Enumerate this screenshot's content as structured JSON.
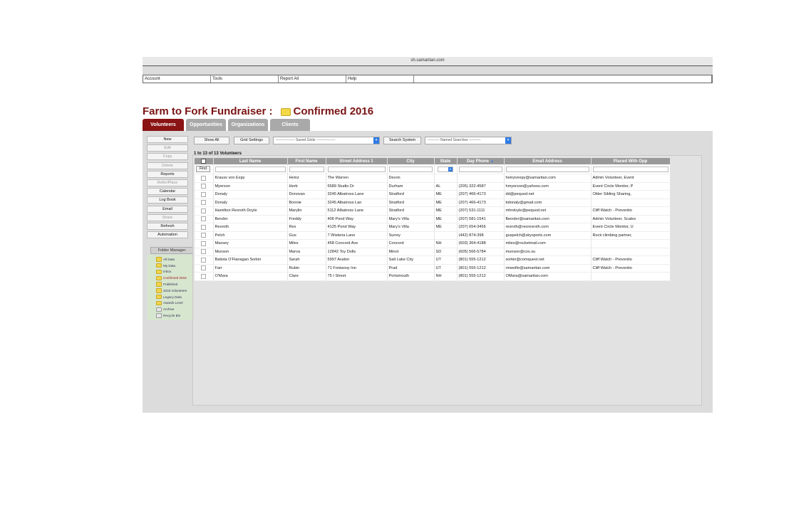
{
  "browser": {
    "url": "sh.samaritan.com"
  },
  "menu": {
    "items": [
      "Account",
      "Tools",
      "Report All",
      "Help"
    ]
  },
  "title": {
    "event": "Farm to Fork Fundraiser :",
    "folder": "Confirmed 2016"
  },
  "tabs": [
    {
      "label": "Volunteers",
      "active": true
    },
    {
      "label": "Opportunities",
      "active": false
    },
    {
      "label": "Organizations",
      "active": false
    },
    {
      "label": "Clients",
      "active": false
    }
  ],
  "sidebar": {
    "buttons": [
      {
        "label": "New",
        "enabled": true
      },
      {
        "label": "Edit",
        "enabled": false
      },
      {
        "label": "Copy",
        "enabled": false
      },
      {
        "label": "Delete",
        "enabled": false
      },
      {
        "label": "Reports",
        "enabled": true
      },
      {
        "label": "Refer/Place",
        "enabled": false
      },
      {
        "label": "Calendar",
        "enabled": true
      },
      {
        "label": "Log Book",
        "enabled": true
      },
      {
        "label": "Email",
        "enabled": true
      },
      {
        "label": "Share",
        "enabled": false
      },
      {
        "label": "Refresh",
        "enabled": true
      },
      {
        "label": "Automation",
        "enabled": true
      }
    ],
    "folder_manager": {
      "header": "Folder Manager",
      "folders": [
        {
          "label": "All Data",
          "active": false,
          "icon": "folder-icon"
        },
        {
          "label": "My Data",
          "active": false,
          "icon": "folder-icon"
        },
        {
          "label": "Inbox",
          "active": false,
          "icon": "folder-icon"
        },
        {
          "label": "Confirmed 2016",
          "active": true,
          "icon": "folder-icon"
        },
        {
          "label": "Published",
          "active": false,
          "icon": "folder-icon"
        },
        {
          "label": "2015 Volunteers",
          "active": false,
          "icon": "folder-icon"
        },
        {
          "label": "Legacy Data",
          "active": false,
          "icon": "folder-icon"
        },
        {
          "label": "Awards Level",
          "active": false,
          "icon": "folder-icon"
        },
        {
          "label": "Archive",
          "active": false,
          "icon": "archive-icon"
        },
        {
          "label": "Recycle Bin",
          "active": false,
          "icon": "recycle-bin-icon"
        }
      ]
    }
  },
  "toolbar": {
    "show_all": "Show All",
    "grid_settings": "Grid Settings",
    "saved_grids": "---------------- Saved Grids ----------------",
    "search_system": "Search System",
    "named_searches": "---------- Named Searches ----------"
  },
  "grid": {
    "count_label": "1 to 13 of 13 Volunteers",
    "find_label": "Find",
    "columns": [
      "Last Name",
      "First Name",
      "Street Address 1",
      "City",
      "State",
      "Day Phone",
      "Email Address",
      "Placed With Opp"
    ],
    "rows": [
      [
        "Krauss von Espy",
        "Heinz",
        "The Warren",
        "Devon",
        "",
        "",
        "heinzvespy@samaritan.com",
        "Admin Volunteer, Event"
      ],
      [
        "Myerson",
        "Herb",
        "6589 Studio Dr",
        "Durham",
        "AL",
        "(205) 322-4587",
        "hmyerson@yahoos.com",
        "Event Circle Monitor, P"
      ],
      [
        "Donaly",
        "Donovan",
        "3245 Albatross Lane",
        "Stratford",
        "ME",
        "(207) 466-4173",
        "dd@pequod.net",
        "Older Sibling Sharing,"
      ],
      [
        "Donaly",
        "Bonnie",
        "3245 Albatross Lan",
        "Stratford",
        "ME",
        "(207) 466-4173",
        "bdonaly@gmail.com",
        ""
      ],
      [
        "Hamilton Rexroth Doyle",
        "Marylin",
        "5112 Albatross Lane",
        "Stratford",
        "ME",
        "(207) 531-1111",
        "mhrdoyle@pequod.net",
        "Cliff Watch - Preventio"
      ],
      [
        "Bender",
        "Freddy",
        "406 Pond Way",
        "Mary's Villa",
        "ME",
        "(207) 581-1541",
        "fbender@samaritan.com",
        "Admin Volunteer, Scales"
      ],
      [
        "Rexroth",
        "Rex",
        "4125 Pond Way",
        "Mary's Villa",
        "ME",
        "(207) 654-3456",
        "rexroth@rexrexroth.com",
        "Event Circle Monitor, U"
      ],
      [
        "Pelch",
        "Gus",
        "7 Wisteria Lane",
        "Surrey",
        "",
        "(442) 874-398",
        "guspelch@skysports.com",
        "Rock climbing partner,"
      ],
      [
        "Massey",
        "Miles",
        "458 Concord Ave",
        "Concord",
        "NH",
        "(603) 364-4188",
        "miles@rocketmail.com",
        ""
      ],
      [
        "Munson",
        "Marva",
        "12842 Toy Dolls",
        "Minot",
        "SD",
        "(605) 566-5784",
        "munson@cox.su",
        ""
      ],
      [
        "Batista O'Flanagan Sorkin",
        "Sarah",
        "5997 Avalon",
        "Salt Lake City",
        "UT",
        "(801) 555-1212",
        "sorkin@comquest.net",
        "Cliff Watch - Preventio"
      ],
      [
        "Farr",
        "Rubin",
        "71 Fontanoy Inn",
        "Prad",
        "UT",
        "(801) 555-1212",
        "rmwolfe@samaritan.com",
        "Cliff Watch - Preventio"
      ],
      [
        "O'Mara",
        "Clare",
        "75 I Street",
        "Portsmouth",
        "NH",
        "(801) 555-1212",
        "OMara@samaritan.com",
        ""
      ]
    ]
  },
  "colors": {
    "brand": "#8a1313",
    "header_gray": "#999999",
    "folder_panel": "#d7e6cf",
    "accent_blue": "#2f7be3"
  }
}
